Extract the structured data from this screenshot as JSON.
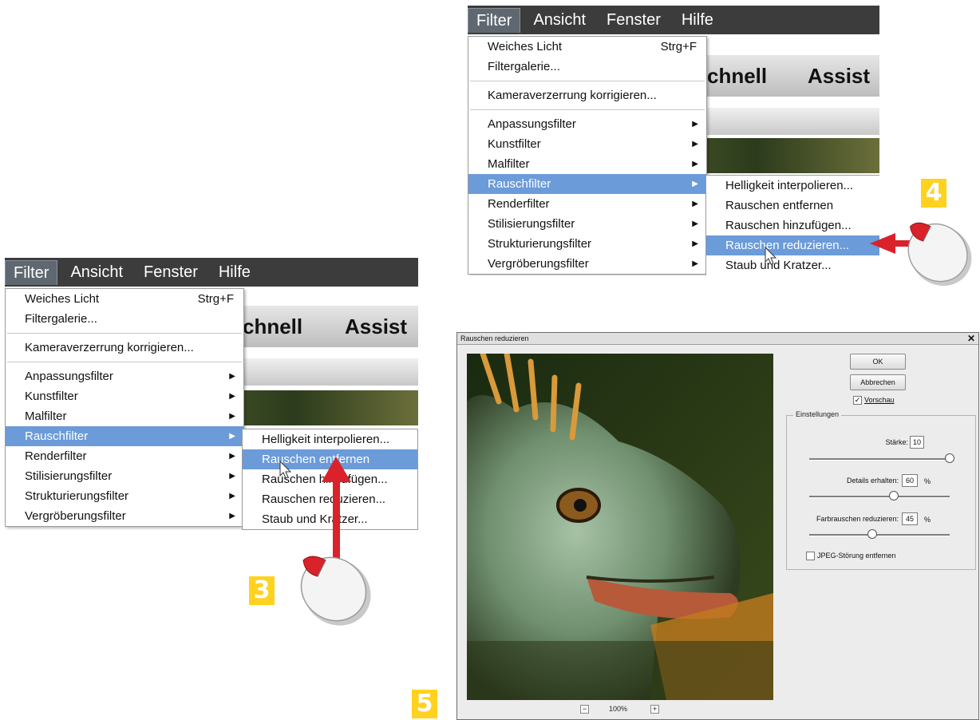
{
  "screens": {
    "step3": {
      "menubar": [
        "Filter",
        "Ansicht",
        "Fenster",
        "Hilfe"
      ],
      "background_text": [
        "chnell",
        "Assist"
      ],
      "dropdown": {
        "group1": [
          {
            "label": "Weiches Licht",
            "shortcut": "Strg+F"
          },
          {
            "label": "Filtergalerie..."
          }
        ],
        "group2": [
          {
            "label": "Kameraverzerrung korrigieren..."
          }
        ],
        "group3": [
          "Anpassungsfilter",
          "Kunstfilter",
          "Malfilter",
          "Rauschfilter",
          "Renderfilter",
          "Stilisierungsfilter",
          "Strukturierungsfilter",
          "Vergröberungsfilter"
        ]
      },
      "submenu": [
        "Helligkeit interpolieren...",
        "Rauschen entfernen",
        "Rauschen hinzufügen...",
        "Rauschen reduzieren...",
        "Staub und Kratzer..."
      ],
      "highlighted_menu": "Rauschfilter",
      "highlighted_submenu": "Rauschen entfernen",
      "badge": "3"
    },
    "step4": {
      "menubar": [
        "Filter",
        "Ansicht",
        "Fenster",
        "Hilfe"
      ],
      "background_text": [
        "chnell",
        "Assist"
      ],
      "dropdown": {
        "group1": [
          {
            "label": "Weiches Licht",
            "shortcut": "Strg+F"
          },
          {
            "label": "Filtergalerie..."
          }
        ],
        "group2": [
          {
            "label": "Kameraverzerrung korrigieren..."
          }
        ],
        "group3": [
          "Anpassungsfilter",
          "Kunstfilter",
          "Malfilter",
          "Rauschfilter",
          "Renderfilter",
          "Stilisierungsfilter",
          "Strukturierungsfilter",
          "Vergröberungsfilter"
        ]
      },
      "submenu": [
        "Helligkeit interpolieren...",
        "Rauschen entfernen",
        "Rauschen hinzufügen...",
        "Rauschen reduzieren...",
        "Staub und Kratzer..."
      ],
      "highlighted_menu": "Rauschfilter",
      "highlighted_submenu": "Rauschen reduzieren...",
      "badge": "4"
    }
  },
  "dialog": {
    "title": "Rauschen reduzieren",
    "close": "✕",
    "ok_label": "OK",
    "cancel_label": "Abbrechen",
    "preview_label": "Vorschau",
    "preview_checked": true,
    "group_label": "Einstellungen",
    "sliders": [
      {
        "label": "Stärke:",
        "value": "10",
        "unit": "",
        "fraction": 1.0
      },
      {
        "label": "Details erhalten:",
        "value": "60",
        "unit": "%",
        "fraction": 0.6
      },
      {
        "label": "Farbrauschen reduzieren:",
        "value": "45",
        "unit": "%",
        "fraction": 0.45
      }
    ],
    "jpeg_label": "JPEG-Störung entfernen",
    "jpeg_checked": false,
    "zoom": "100%",
    "zoom_out": "−",
    "zoom_in": "+"
  },
  "badge5": "5",
  "colors": {
    "highlight": "#6b9bd9",
    "menubar": "#3c3c3c",
    "badge": "#ffd21f",
    "arrow": "#d9222a"
  },
  "icons": [
    "mouse-icon",
    "cursor-icon",
    "arrow-icon",
    "submenu-arrow-icon",
    "checkbox-icon"
  ]
}
